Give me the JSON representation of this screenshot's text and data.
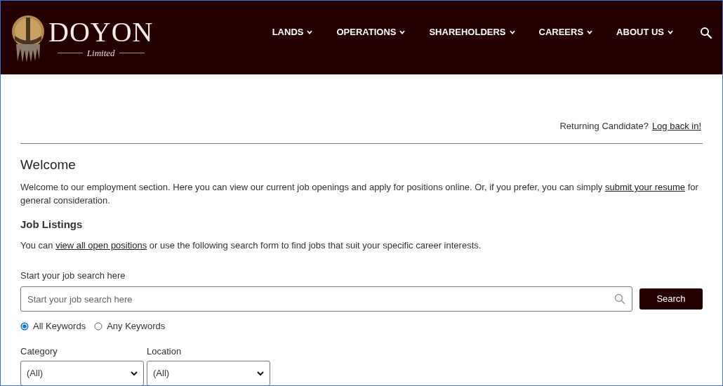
{
  "logo": {
    "name": "DOYON",
    "tagline": "Limited"
  },
  "nav": [
    {
      "label": "LANDS"
    },
    {
      "label": "OPERATIONS"
    },
    {
      "label": "SHAREHOLDERS"
    },
    {
      "label": "CAREERS"
    },
    {
      "label": "ABOUT US"
    }
  ],
  "returning": {
    "text": "Returning Candidate?",
    "link": "Log back in!"
  },
  "welcome": {
    "title": "Welcome",
    "paragraph": {
      "before": "Welcome to our employment section. Here you can view our current job openings and apply for positions online. Or, if you prefer, you can simply ",
      "link": "submit your resume",
      "after": " for general consideration."
    }
  },
  "job_listings": {
    "title": "Job Listings",
    "paragraph": {
      "before": "You can ",
      "link": "view all open positions",
      "after": " or use the following search form to find jobs that suit your specific career interests."
    }
  },
  "search": {
    "label": "Start your job search here",
    "placeholder": "Start your job search here",
    "button": "Search"
  },
  "match_options": [
    {
      "label": "All Keywords",
      "selected": true
    },
    {
      "label": "Any Keywords",
      "selected": false
    }
  ],
  "filters": [
    {
      "label": "Category",
      "value": "(All)"
    },
    {
      "label": "Location",
      "value": "(All)"
    }
  ]
}
